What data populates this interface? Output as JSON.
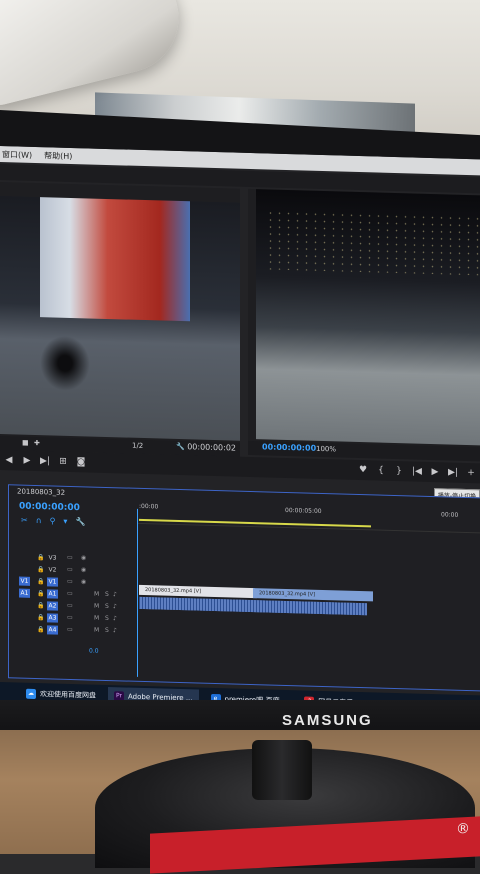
{
  "menubar": {
    "items": [
      "窗口(W)",
      "帮助(H)"
    ]
  },
  "source_monitor": {
    "fraction": "1/2",
    "timecode": "00:00:00:02"
  },
  "program_monitor": {
    "timecode": "00:00:00:00",
    "zoom": "100%"
  },
  "tooltip": {
    "text": "播放-停止切换"
  },
  "timeline": {
    "sequence_tab": "20180803_32",
    "timecode": "00:00:00:00",
    "ruler": {
      "start": ":00:00",
      "mid": "00:00:05:00",
      "end": "00:00"
    },
    "video_tracks": [
      "V3",
      "V2",
      "V1"
    ],
    "audio_tracks": [
      "A1",
      "A2",
      "A3",
      "A4"
    ],
    "source_patch_v": "V1",
    "source_patch_a": "A1",
    "audio_footer": "0.0",
    "clip1": "20180803_32.mp4 [V]",
    "clip2": "20180803_32.mp4 [V]"
  },
  "taskbar": {
    "items": [
      "欢迎使用百度网盘",
      "Adobe Premiere ...",
      "premiere吧-百度...",
      "网易云音乐"
    ]
  },
  "monitor_brand": "SAMSUNG",
  "box_mark": "®"
}
